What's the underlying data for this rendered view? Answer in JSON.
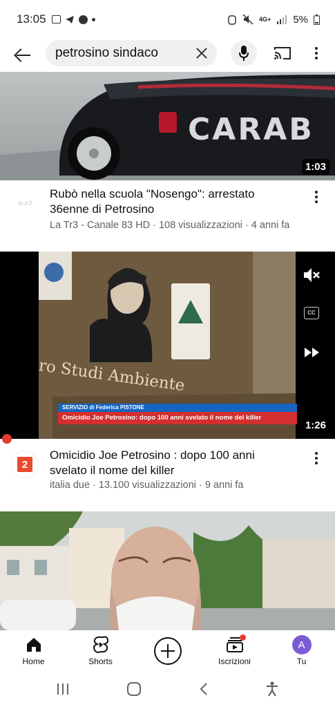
{
  "status": {
    "time": "13:05",
    "network": "4G+",
    "battery": "5%"
  },
  "search": {
    "query": "petrosino sindaco"
  },
  "videos": [
    {
      "title": "Rubò nella scuola \"Nosengo\": arrestato 36enne di Petrosino",
      "meta": "La Tr3 - Canale 83 HD · 108 visualizzazioni · 4 anni fa",
      "duration": "1:03",
      "thumb_text": "CARAB",
      "channel_avatar_text": "la tr3"
    },
    {
      "title": "Omicidio Joe Petrosino : dopo 100 anni svelato il nome del killer",
      "meta": "italia due · 13.100 visualizzazioni · 9 anni fa",
      "duration": "1:26",
      "banner_top": "SERVIZIO di Federica PISTONE",
      "banner_main": "Omicidio Joe Petrosino: dopo 100 anni svelato il nome del killer",
      "plaque_text": "ro Studi Ambiente",
      "channel_avatar_text": "2"
    }
  ],
  "bottom_nav": {
    "home": "Home",
    "shorts": "Shorts",
    "subscriptions": "Iscrizioni",
    "you": "Tu",
    "avatar_letter": "A"
  },
  "colors": {
    "accent_red": "#e53935",
    "avatar_purple": "#7b5cd6",
    "banner_blue": "#1565c0",
    "banner_red": "#d32f2f"
  },
  "icons": [
    "back-arrow-icon",
    "clear-icon",
    "mic-icon",
    "cast-icon",
    "more-vert-icon",
    "mute-icon",
    "captions-icon",
    "fast-forward-icon",
    "home-icon",
    "shorts-icon",
    "create-icon",
    "subscriptions-icon"
  ]
}
